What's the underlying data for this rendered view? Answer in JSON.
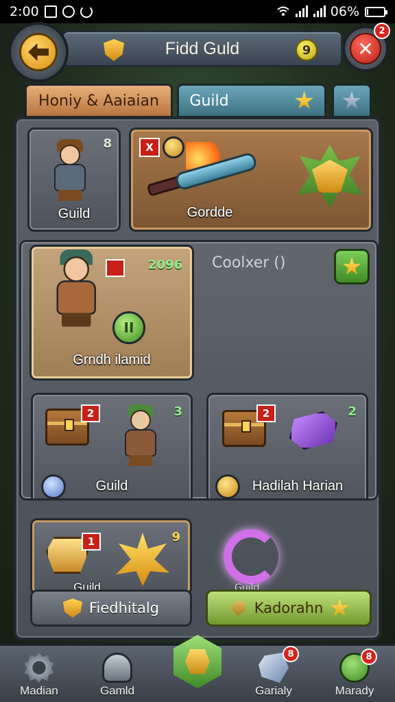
{
  "status_bar": {
    "time": "2:00",
    "battery": "06%",
    "battery_fraction": 0.06
  },
  "header": {
    "title": "Fidd Guld",
    "coin_value": "9",
    "close_badge": "2"
  },
  "tabs": [
    {
      "label": "Honiy & Aaiaian"
    },
    {
      "label": "Guild"
    },
    {
      "label": ""
    }
  ],
  "top_row": {
    "guild_card": {
      "label": "Guild",
      "count": "8"
    },
    "gorde_card": {
      "label": "Gordde",
      "close_tag": "X"
    }
  },
  "featured": {
    "card_label": "Grndh ilamid",
    "number": "2096",
    "side_label": "Coolxer ()",
    "badge_text": "II"
  },
  "grid": [
    {
      "label": "Guild",
      "tag": "2",
      "count": "3"
    },
    {
      "label": "Hadilah Harian",
      "tag": "2",
      "count": "2"
    }
  ],
  "bottom_row": {
    "left_partial_label": "Guild",
    "left_tag": "1",
    "left_count": "9",
    "right_partial_label": "Guild"
  },
  "actions": {
    "left_label": "Fiedhitalg",
    "right_label": "Kadorahn"
  },
  "bottom_nav": [
    {
      "label": "Madian",
      "badge": ""
    },
    {
      "label": "Gamld",
      "badge": ""
    },
    {
      "label": "",
      "badge": ""
    },
    {
      "label": "Garialy",
      "badge": "8"
    },
    {
      "label": "Marady",
      "badge": "8"
    }
  ],
  "colors": {
    "accent_gold": "#ffd454",
    "accent_green": "#6f9a2e",
    "badge_red": "#d8231c",
    "panel_grey": "#545a62"
  }
}
